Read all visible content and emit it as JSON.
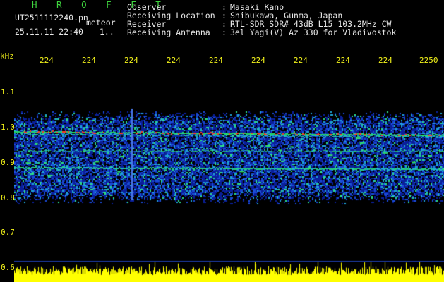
{
  "header": {
    "title": "H R O F F T",
    "filename": "UT2511112240.pn",
    "subtitle": "meteor",
    "datetime": "25.11.11 22:40",
    "count": "1.."
  },
  "info": [
    {
      "label": "Observer",
      "sep": ":",
      "value": "Masaki Kano"
    },
    {
      "label": "Receiving Location",
      "sep": ":",
      "value": "Shibukawa, Gunma, Japan"
    },
    {
      "label": "Receiver",
      "sep": ":",
      "value": "RTL-SDR SDR# 43dB L15 103.2MHz CW"
    },
    {
      "label": "Receiving Antenna",
      "sep": ":",
      "value": "3el Yagi(V) Az 330 for Vladivostok"
    }
  ],
  "axis": {
    "unit": "kHz",
    "time_ticks": [
      "224",
      "224",
      "224",
      "224",
      "224",
      "224",
      "224",
      "224",
      "224",
      "2250"
    ],
    "freq_ticks": [
      "1.1",
      "1.0",
      "0.9",
      "0.8",
      "0.7",
      "0.6"
    ]
  },
  "colors": {
    "header_green": "#3ed33e",
    "info_cyan": "#5fe0e0",
    "tick_yellow": "#f2f21a",
    "noise_blue": "#0a2fd0",
    "band_green": "#21d97a",
    "band_red": "#ff3a1a",
    "amplitude_yellow": "#ffff00"
  }
}
